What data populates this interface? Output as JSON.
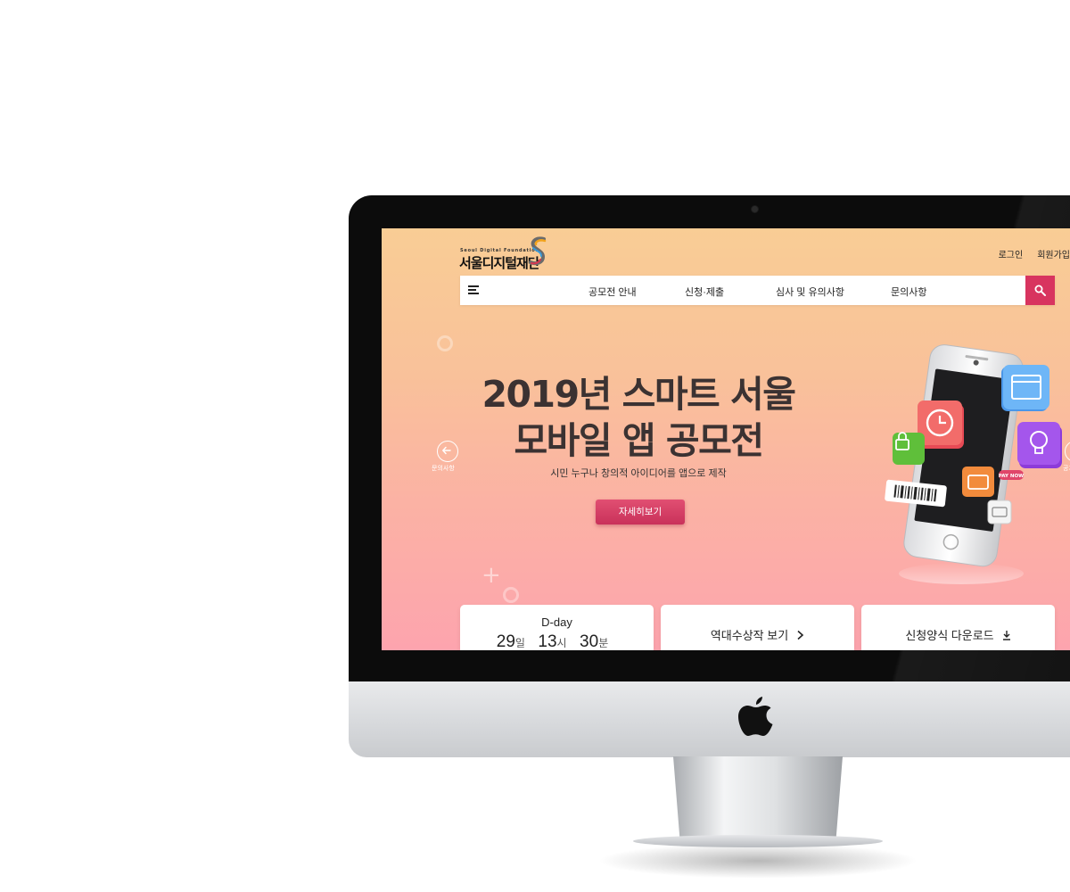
{
  "site": {
    "logo_tagline": "Seoul Digital Foundation",
    "logo_name": "서울디지털재단",
    "util_links": {
      "login": "로그인",
      "signup": "회원가입"
    }
  },
  "nav": {
    "menu_icon": "hamburger-menu-icon",
    "items": [
      "공모전 안내",
      "신청·제출",
      "심사 및 유의사항",
      "문의사항"
    ],
    "search_icon": "search-icon"
  },
  "hero": {
    "title_line1": "2019년 스마트 서울",
    "title_line2": "모바일 앱 공모전",
    "subtitle": "시민 누구나 창의적 아이디어를 앱으로 제작",
    "cta_label": "자세히보기",
    "prev_label": "문의사항",
    "next_label": "공지"
  },
  "illustration": {
    "pay_badge": "PAY NOW",
    "icons": [
      "calendar-icon",
      "clock-icon",
      "lock-icon",
      "lightbulb-icon",
      "wallet-icon",
      "barcode-icon",
      "credit-card-icon"
    ]
  },
  "cards": {
    "dday": {
      "title": "D-day",
      "days": "29",
      "days_unit": "일",
      "hours": "13",
      "hours_unit": "시",
      "minutes": "30",
      "minutes_unit": "분"
    },
    "awards": {
      "label": "역대수상작 보기",
      "icon": "chevron-right-icon"
    },
    "form": {
      "label": "신청양식 다운로드",
      "icon": "download-icon"
    }
  },
  "colors": {
    "accent": "#d8345f",
    "bg_top": "#f9cd95",
    "bg_bottom": "#fda4ae",
    "title": "#3b3232"
  }
}
